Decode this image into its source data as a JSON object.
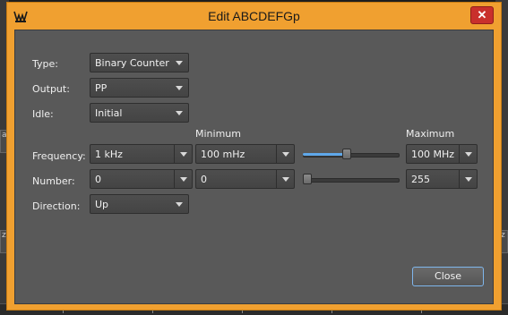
{
  "window": {
    "title": "Edit ABCDEFGp",
    "close_glyph": "✕"
  },
  "background": {
    "side_marks": [
      "a",
      "z",
      "z"
    ]
  },
  "colors": {
    "accent": "#f0a030",
    "panel": "#595959",
    "slider_fill": "#5fa8ea"
  },
  "form": {
    "type": {
      "label": "Type:",
      "value": "Binary Counter"
    },
    "output": {
      "label": "Output:",
      "value": "PP"
    },
    "idle": {
      "label": "Idle:",
      "value": "Initial"
    },
    "minimum_header": "Minimum",
    "maximum_header": "Maximum",
    "frequency": {
      "label": "Frequency:",
      "value": "1 kHz",
      "min": "100 mHz",
      "max": "100 MHz",
      "slider_fraction": 0.45
    },
    "number": {
      "label": "Number:",
      "value": "0",
      "min": "0",
      "max": "255",
      "slider_fraction": 0.0
    },
    "direction": {
      "label": "Direction:",
      "value": "Up"
    }
  },
  "buttons": {
    "close": "Close"
  }
}
